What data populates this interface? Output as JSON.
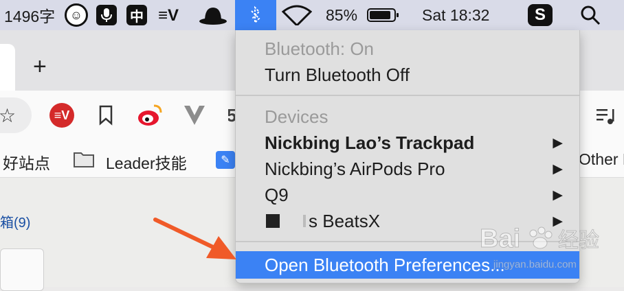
{
  "menubar": {
    "word_count": "1496字",
    "input_method": "中",
    "battery": "85%",
    "clock": "Sat 18:32",
    "icons": [
      "smiley-icon",
      "microphone-icon",
      "chinese-input-icon",
      "expressvpn-icon",
      "hat-icon",
      "bluetooth-icon",
      "wifi-icon",
      "battery-icon",
      "s-app-icon",
      "search-icon"
    ]
  },
  "browser": {
    "new_tab_label": "+",
    "bookmarks": {
      "item1": "好站点",
      "item2": "Leader技能",
      "item3": "Other B"
    },
    "content_link": "箱(9)"
  },
  "bluetooth_menu": {
    "status": "Bluetooth: On",
    "toggle": "Turn Bluetooth Off",
    "devices_header": "Devices",
    "devices": [
      {
        "name": "Nickbing Lao’s Trackpad",
        "bold": true
      },
      {
        "name": "Nickbing’s AirPods Pro",
        "bold": false
      },
      {
        "name": "Q9",
        "bold": false
      },
      {
        "name": "s BeatsX",
        "bold": false
      }
    ],
    "preferences": "Open Bluetooth Preferences...",
    "submenu_arrow": "▶"
  },
  "annotation": {
    "arrow_color": "#f05a28"
  },
  "watermark": {
    "brand": "Bai",
    "brand2": "经验",
    "url": "jingyan.baidu.com"
  }
}
